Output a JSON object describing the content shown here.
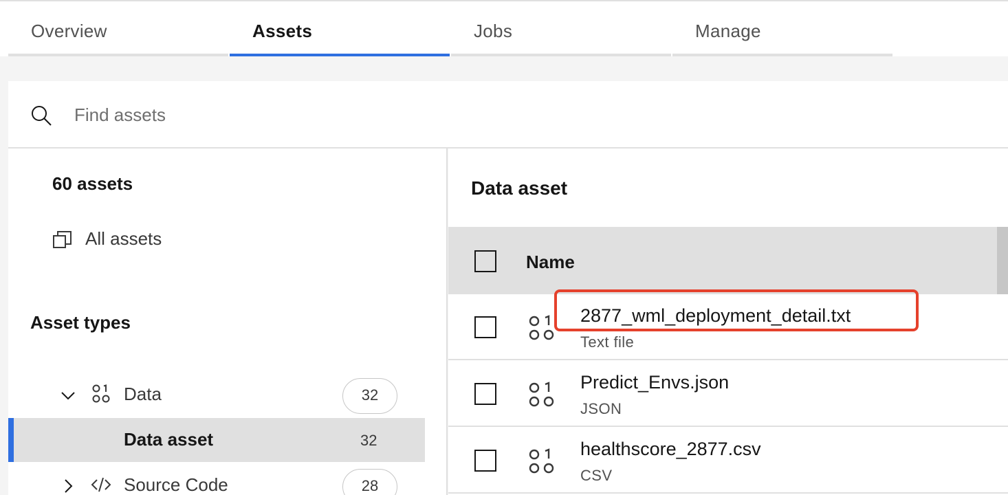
{
  "tabs": [
    {
      "label": "Overview"
    },
    {
      "label": "Assets"
    },
    {
      "label": "Jobs"
    },
    {
      "label": "Manage"
    }
  ],
  "search": {
    "placeholder": "Find assets",
    "icon": "search-icon"
  },
  "sidebar": {
    "count_label": "60 assets",
    "all_assets_label": "All assets",
    "asset_types_heading": "Asset types",
    "tree": [
      {
        "label": "Data",
        "count": "32",
        "expanded": true,
        "icon": "data-icon"
      },
      {
        "label": "Data asset",
        "count": "32",
        "selected": true
      },
      {
        "label": "Source Code",
        "count": "28",
        "expanded": false,
        "icon": "code-icon"
      }
    ]
  },
  "main": {
    "title": "Data asset",
    "column_name": "Name",
    "rows": [
      {
        "name": "2877_wml_deployment_detail.txt",
        "type": "Text file"
      },
      {
        "name": "Predict_Envs.json",
        "type": "JSON"
      },
      {
        "name": "healthscore_2877.csv",
        "type": "CSV"
      }
    ]
  },
  "colors": {
    "accent": "#2f6fe0",
    "highlight": "#e5412c",
    "selected_bg": "#e0e0e0"
  }
}
